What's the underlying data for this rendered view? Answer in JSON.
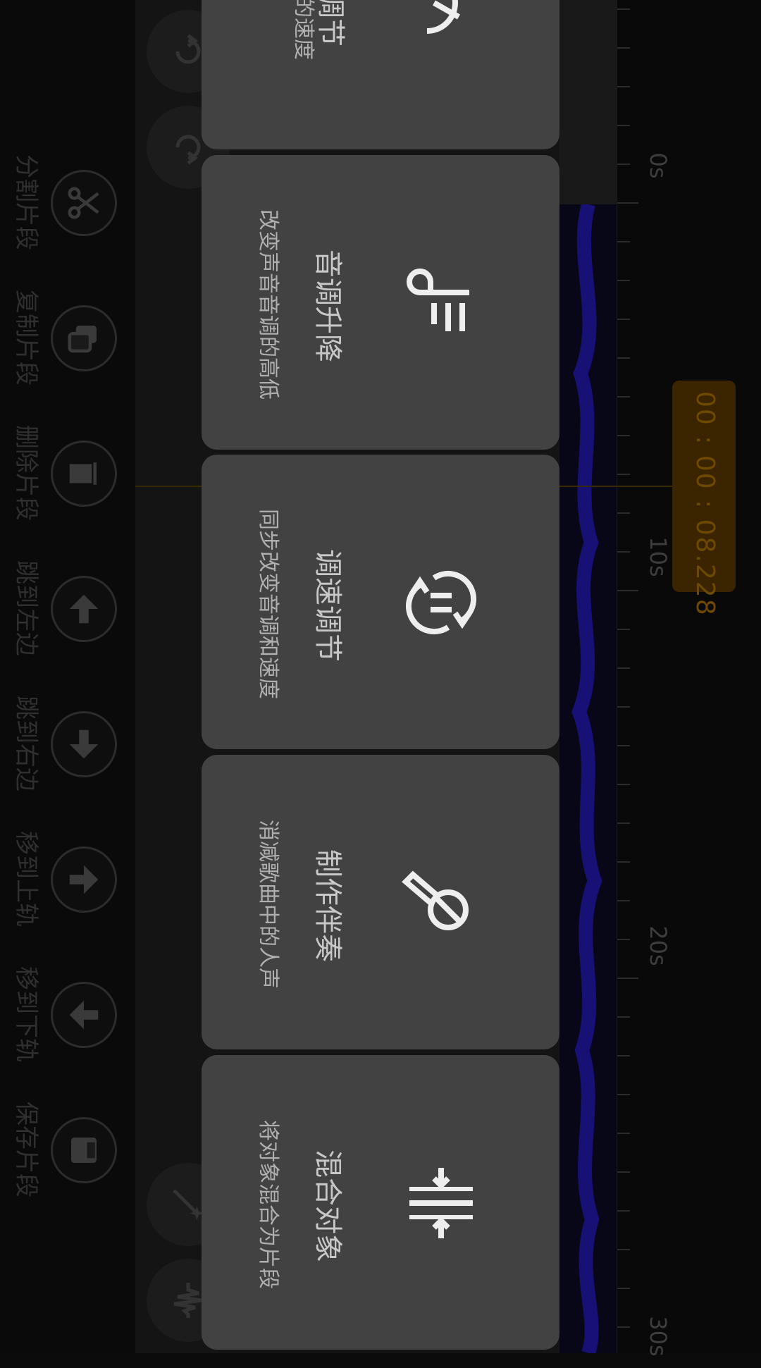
{
  "toolbar": {
    "items": [
      {
        "label": "分割片段",
        "icon": "scissors-icon"
      },
      {
        "label": "复制片段",
        "icon": "copy-icon"
      },
      {
        "label": "删除片段",
        "icon": "trash-icon"
      },
      {
        "label": "跳到左边",
        "icon": "arrow-up-icon"
      },
      {
        "label": "跳到右边",
        "icon": "arrow-down-icon"
      },
      {
        "label": "移到上轨",
        "icon": "arrow-right-icon"
      },
      {
        "label": "移到下轨",
        "icon": "arrow-left-icon"
      },
      {
        "label": "保存片段",
        "icon": "save-icon"
      }
    ]
  },
  "timeline": {
    "labels": [
      "0s",
      "10s",
      "20s",
      "30s"
    ],
    "current_time": "00 : 00 : 08.228"
  },
  "menu": {
    "cards": [
      {
        "title": "调节",
        "subtitle": "播放的速度",
        "icon": "speedometer-icon"
      },
      {
        "title": "音调升降",
        "subtitle": "改变声音音调的高低",
        "icon": "pitch-icon"
      },
      {
        "title": "调速调节",
        "subtitle": "同步改变音调和速度",
        "icon": "tempo-cycle-icon"
      },
      {
        "title": "制作伴奏",
        "subtitle": "消减歌曲中的人声",
        "icon": "no-vocal-mic-icon"
      },
      {
        "title": "混合对象",
        "subtitle": "将对象混合为片段",
        "icon": "merge-icon"
      }
    ]
  },
  "colors": {
    "card_bg": "#424242",
    "waveform": "#1a1280",
    "time_badge": "#3a2500"
  }
}
